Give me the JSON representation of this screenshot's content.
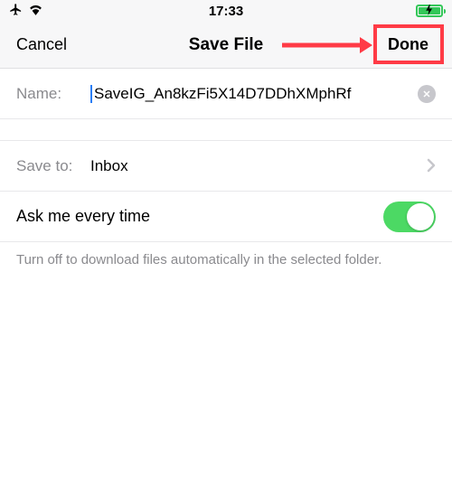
{
  "status": {
    "time": "17:33"
  },
  "nav": {
    "cancel": "Cancel",
    "title": "Save File",
    "done": "Done"
  },
  "name_row": {
    "label": "Name:",
    "value": "SaveIG_An8kzFi5X14D7DDhXMphRf"
  },
  "saveto_row": {
    "label": "Save to:",
    "value": "Inbox"
  },
  "toggle": {
    "label": "Ask me every time"
  },
  "helper": "Turn off to download files automatically in the selected folder."
}
